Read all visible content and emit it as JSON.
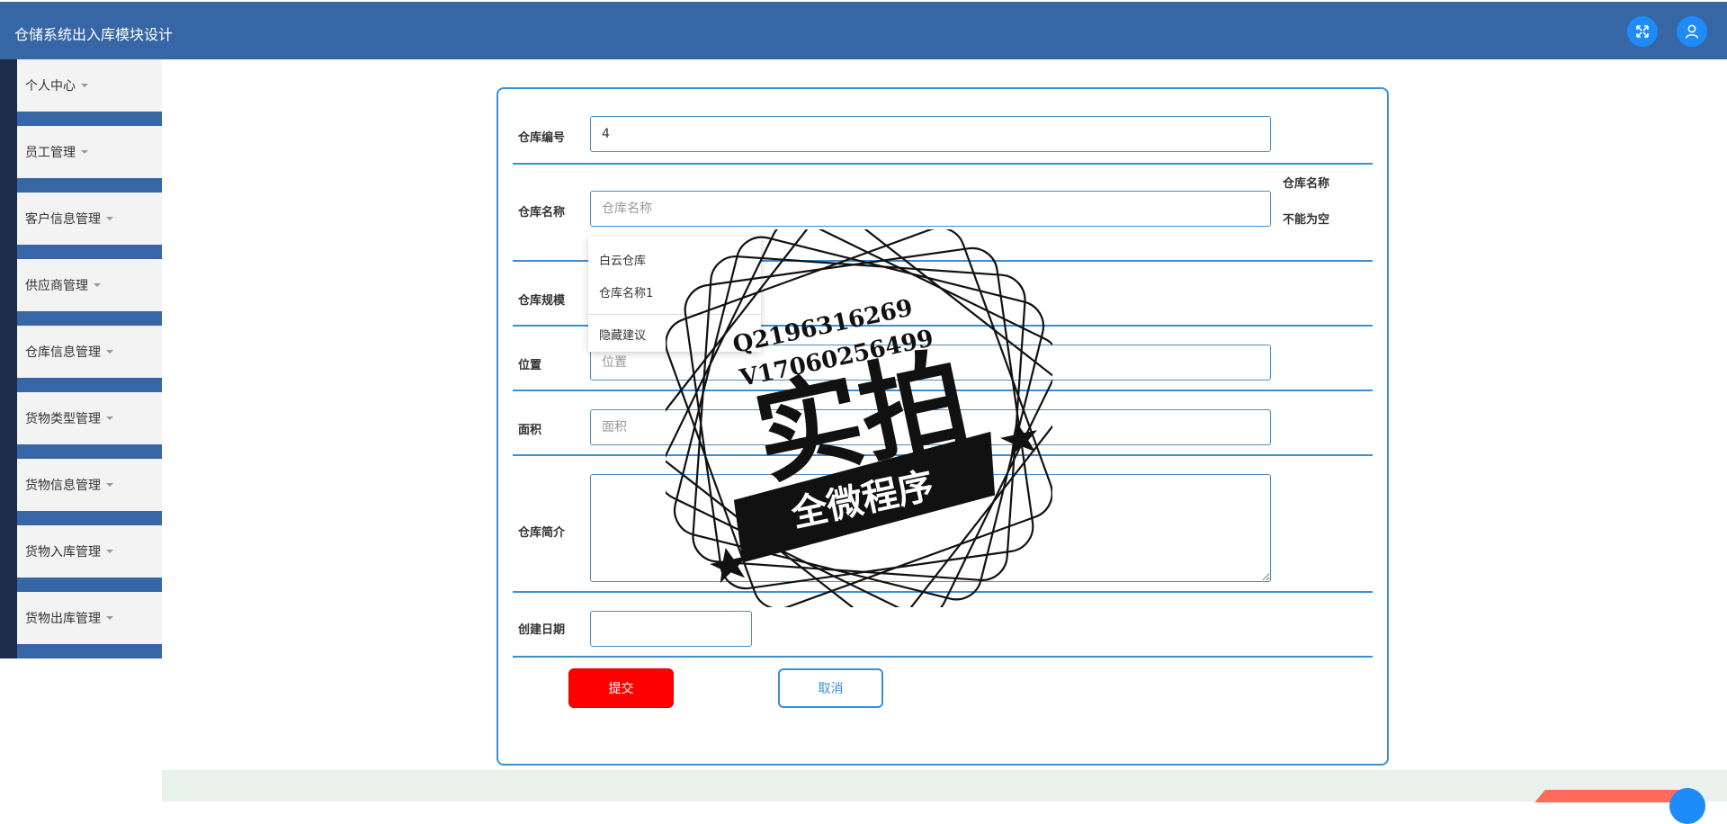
{
  "app": {
    "title": "仓储系统出入库模块设计"
  },
  "header_icons": [
    "fullscreen-icon",
    "user-icon"
  ],
  "sidebar": {
    "items": [
      {
        "label": "个人中心"
      },
      {
        "label": "员工管理"
      },
      {
        "label": "客户信息管理"
      },
      {
        "label": "供应商管理"
      },
      {
        "label": "仓库信息管理"
      },
      {
        "label": "货物类型管理"
      },
      {
        "label": "货物信息管理"
      },
      {
        "label": "货物入库管理"
      },
      {
        "label": "货物出库管理"
      }
    ]
  },
  "form": {
    "warehouse_no": {
      "label": "仓库编号",
      "value": "4"
    },
    "warehouse_name": {
      "label": "仓库名称",
      "placeholder": "仓库名称",
      "error": "仓库名称不能为空"
    },
    "warehouse_scale": {
      "label": "仓库规模"
    },
    "location": {
      "label": "位置",
      "placeholder": "位置"
    },
    "area": {
      "label": "面积",
      "placeholder": "面积"
    },
    "intro": {
      "label": "仓库简介"
    },
    "created_date": {
      "label": "创建日期"
    },
    "submit_label": "提交",
    "cancel_label": "取消"
  },
  "autocomplete": {
    "suggestions": [
      "白云仓库",
      "仓库名称1"
    ],
    "hide_label": "隐藏建议"
  },
  "watermark": {
    "qq": "Q2196316269",
    "wechat": "V17060256499",
    "main": "实拍",
    "banner": "全微程序"
  },
  "colors": {
    "header": "#3766a7",
    "sidebar_dark": "#1c2c4a",
    "accent": "#3a8fd6",
    "submit": "#ff0000"
  }
}
